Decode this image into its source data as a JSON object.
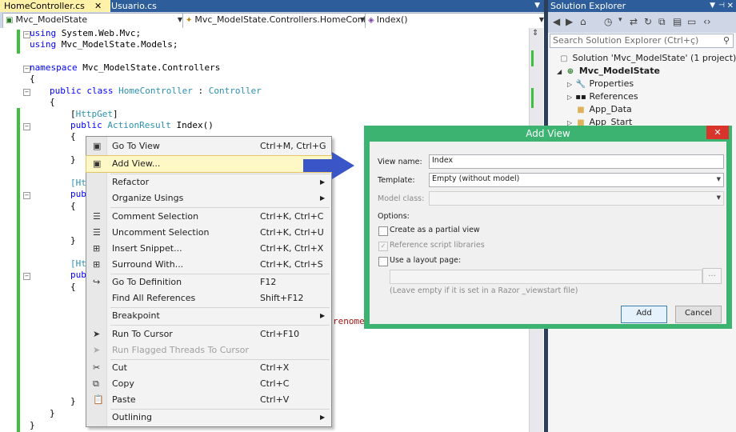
{
  "tabs": {
    "active": "HomeController.cs",
    "other": "Usuario.cs",
    "close_glyph": "✕"
  },
  "navbar": {
    "project": "Mvc_ModelState",
    "class": "Mvc_ModelState.Controllers.HomeCont",
    "member": "Index()"
  },
  "code": {
    "l1_kw": "using",
    "l1_ns": " System.Web.Mvc;",
    "l2_kw": "using",
    "l2_ns": " Mvc_ModelState.Models;",
    "l3_kw": "namespace",
    "l3_ns": " Mvc_ModelState.Controllers",
    "brace_open": "{",
    "brace_close": "}",
    "l5_kw": "public class",
    "l5_type": "HomeController",
    "l5_colon": " : ",
    "l5_base": "Controller",
    "l7_attr_open": "[",
    "l7_attr": "HttpGet",
    "l7_attr_close": "]",
    "l8_kw": "public",
    "l8_type": "ActionResult",
    "l8_name": " Index()",
    "frag_htt": "[Htt",
    "frag_pub": "publ",
    "frag_renome": "renome"
  },
  "context_menu": {
    "items": [
      {
        "label": "Go To View",
        "shortcut": "Ctrl+M, Ctrl+G"
      },
      {
        "label": "Add View...",
        "shortcut": ""
      },
      {
        "label": "Refactor",
        "shortcut": ""
      },
      {
        "label": "Organize Usings",
        "shortcut": ""
      },
      {
        "label": "Comment Selection",
        "shortcut": "Ctrl+K, Ctrl+C"
      },
      {
        "label": "Uncomment Selection",
        "shortcut": "Ctrl+K, Ctrl+U"
      },
      {
        "label": "Insert Snippet...",
        "shortcut": "Ctrl+K, Ctrl+X"
      },
      {
        "label": "Surround With...",
        "shortcut": "Ctrl+K, Ctrl+S"
      },
      {
        "label": "Go To Definition",
        "shortcut": "F12"
      },
      {
        "label": "Find All References",
        "shortcut": "Shift+F12"
      },
      {
        "label": "Breakpoint",
        "shortcut": ""
      },
      {
        "label": "Run To Cursor",
        "shortcut": "Ctrl+F10"
      },
      {
        "label": "Run Flagged Threads To Cursor",
        "shortcut": ""
      },
      {
        "label": "Cut",
        "shortcut": "Ctrl+X"
      },
      {
        "label": "Copy",
        "shortcut": "Ctrl+C"
      },
      {
        "label": "Paste",
        "shortcut": "Ctrl+V"
      },
      {
        "label": "Outlining",
        "shortcut": ""
      }
    ],
    "highlighted": "Add View...",
    "disabled": [
      "Run Flagged Threads To Cursor"
    ]
  },
  "solution_explorer": {
    "title": "Solution Explorer",
    "search_placeholder": "Search Solution Explorer (Ctrl+ç)",
    "solution": "Solution 'Mvc_ModelState' (1 project)",
    "project": "Mvc_ModelState",
    "items": [
      "Properties",
      "References",
      "App_Data",
      "App_Start"
    ]
  },
  "add_view": {
    "title": "Add View",
    "view_name_label": "View name:",
    "view_name": "Index",
    "template_label": "Template:",
    "template": "Empty (without model)",
    "model_class_label": "Model class:",
    "model_class": "",
    "options_label": "Options:",
    "partial_label": "Create as a partial view",
    "partial_checked": false,
    "scripts_label": "Reference script libraries",
    "scripts_checked": true,
    "layout_label": "Use a layout page:",
    "layout_checked": false,
    "layout_path": "",
    "browse_label": "...",
    "hint": "(Leave empty if it is set in a Razor _viewstart file)",
    "add_label": "Add",
    "cancel_label": "Cancel",
    "close_glyph": "✕"
  },
  "colors": {
    "accent": "#2d5d9b",
    "dialog_frame": "#3cb371",
    "change_marker": "#3fbf3f",
    "arrow": "#3a55c8"
  }
}
